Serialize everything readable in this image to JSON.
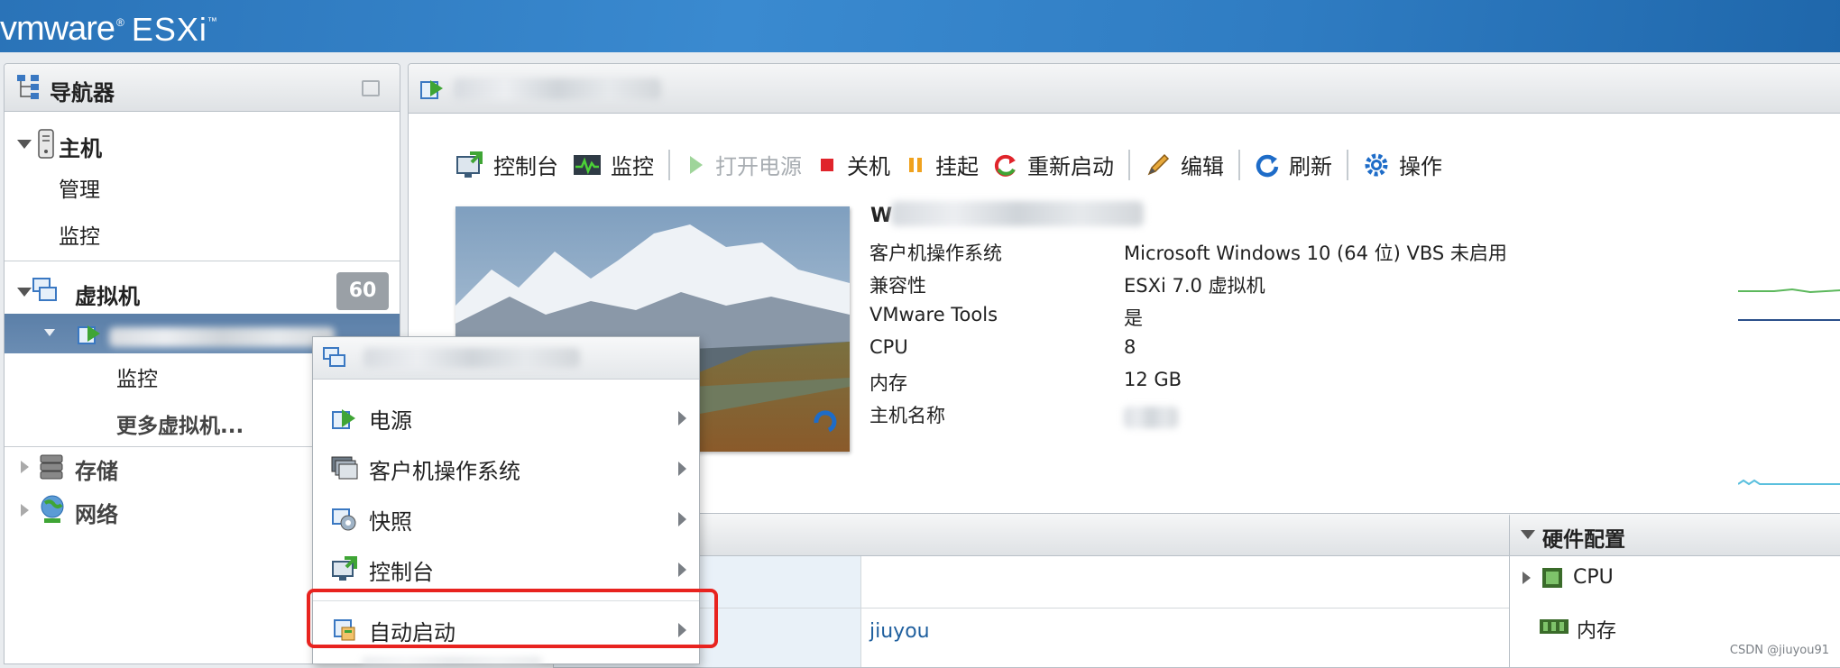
{
  "brand": {
    "vm": "vmware",
    "registered": "®",
    "product": "ESXi",
    "tm": "™"
  },
  "navigator": {
    "title": "导航器",
    "host": {
      "label": "主机",
      "children": [
        "管理",
        "监控"
      ]
    },
    "vms": {
      "label": "虚拟机",
      "count": "60",
      "children": [
        "监控",
        "更多虚拟机..."
      ]
    },
    "storage": {
      "label": "存储"
    },
    "network": {
      "label": "网络"
    }
  },
  "toolbar": {
    "console": "控制台",
    "monitor": "监控",
    "power_on": "打开电源",
    "shutdown": "关机",
    "suspend": "挂起",
    "restart": "重新启动",
    "edit": "编辑",
    "refresh": "刷新",
    "actions": "操作"
  },
  "vm_info": {
    "name_prefix": "W",
    "rows": [
      {
        "label": "客户机操作系统",
        "value": "Microsoft Windows 10 (64 位) VBS 未启用"
      },
      {
        "label": "兼容性",
        "value": "ESXi 7.0 虚拟机"
      },
      {
        "label": "VMware Tools",
        "value": "是"
      },
      {
        "label": "CPU",
        "value": "8"
      },
      {
        "label": "内存",
        "value": "12 GB"
      },
      {
        "label": "主机名称",
        "value": ""
      }
    ]
  },
  "general_panel": {
    "owner_value": "jiuyou"
  },
  "hardware_panel": {
    "title": "硬件配置",
    "items": [
      "CPU",
      "内存"
    ]
  },
  "context_menu": {
    "items": [
      "电源",
      "客户机操作系统",
      "快照",
      "控制台",
      "自动启动"
    ]
  },
  "watermark": "CSDN @jiuyou91",
  "colors": {
    "header_blue": "#2f7cc2",
    "highlight_red": "#e8231f",
    "link_blue": "#1f5f9e"
  }
}
